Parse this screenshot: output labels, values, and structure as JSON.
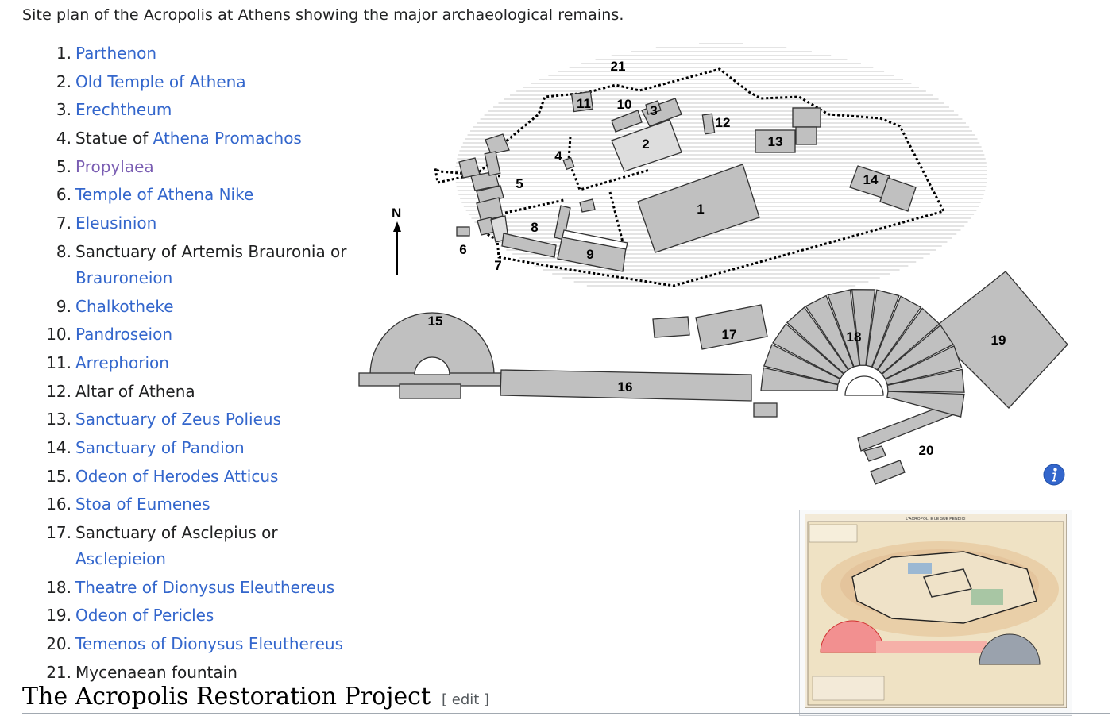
{
  "caption": "Site plan of the Acropolis at Athens showing the major archaeological remains.",
  "list": [
    {
      "num": "1.",
      "parts": [
        {
          "t": "Parthenon",
          "link": true
        }
      ]
    },
    {
      "num": "2.",
      "parts": [
        {
          "t": "Old Temple of Athena",
          "link": true
        }
      ]
    },
    {
      "num": "3.",
      "parts": [
        {
          "t": "Erechtheum",
          "link": true
        }
      ]
    },
    {
      "num": "4.",
      "parts": [
        {
          "t": "Statue of ",
          "link": false
        },
        {
          "t": "Athena Promachos",
          "link": true
        }
      ]
    },
    {
      "num": "5.",
      "parts": [
        {
          "t": "Propylaea",
          "link": true,
          "visited": true
        }
      ]
    },
    {
      "num": "6.",
      "parts": [
        {
          "t": "Temple of Athena Nike",
          "link": true
        }
      ]
    },
    {
      "num": "7.",
      "parts": [
        {
          "t": "Eleusinion",
          "link": true
        }
      ]
    },
    {
      "num": "8.",
      "parts": [
        {
          "t": "Sanctuary of Artemis Brauronia or ",
          "link": false
        },
        {
          "t": "Brauroneion",
          "link": true
        }
      ]
    },
    {
      "num": "9.",
      "parts": [
        {
          "t": "Chalkotheke",
          "link": true
        }
      ]
    },
    {
      "num": "10.",
      "parts": [
        {
          "t": "Pandroseion",
          "link": true
        }
      ]
    },
    {
      "num": "11.",
      "parts": [
        {
          "t": "Arrephorion",
          "link": true
        }
      ]
    },
    {
      "num": "12.",
      "parts": [
        {
          "t": "Altar of Athena",
          "link": false
        }
      ]
    },
    {
      "num": "13.",
      "parts": [
        {
          "t": "Sanctuary of Zeus Polieus",
          "link": true
        }
      ]
    },
    {
      "num": "14.",
      "parts": [
        {
          "t": "Sanctuary of Pandion",
          "link": true
        }
      ]
    },
    {
      "num": "15.",
      "parts": [
        {
          "t": "Odeon of Herodes Atticus",
          "link": true
        }
      ]
    },
    {
      "num": "16.",
      "parts": [
        {
          "t": "Stoa of Eumenes",
          "link": true
        }
      ]
    },
    {
      "num": "17.",
      "parts": [
        {
          "t": "Sanctuary of Asclepius or ",
          "link": false
        },
        {
          "t": "Asclepieion",
          "link": true
        }
      ]
    },
    {
      "num": "18.",
      "parts": [
        {
          "t": "Theatre of Dionysus Eleuthereus",
          "link": true
        }
      ]
    },
    {
      "num": "19.",
      "parts": [
        {
          "t": "Odeon of Pericles",
          "link": true
        }
      ]
    },
    {
      "num": "20.",
      "parts": [
        {
          "t": "Temenos of Dionysus Eleuthereus",
          "link": true
        }
      ]
    },
    {
      "num": "21.",
      "parts": [
        {
          "t": "Mycenaean fountain",
          "link": false
        }
      ]
    }
  ],
  "plan": {
    "north_label": "N",
    "labels": [
      "1",
      "2",
      "3",
      "4",
      "5",
      "6",
      "7",
      "8",
      "9",
      "10",
      "11",
      "12",
      "13",
      "14",
      "15",
      "16",
      "17",
      "18",
      "19",
      "20",
      "21"
    ]
  },
  "thumbnail": {
    "map_title": "L'ACROPOLI E LE SUE PENDICI"
  },
  "section": {
    "title": "The Acropolis Restoration Project",
    "edit_label": "[ edit ]"
  },
  "colors": {
    "link": "#3366cc",
    "visited": "#795cb2",
    "building_fill": "#c0c0c0",
    "info_icon": "#3366cc"
  }
}
